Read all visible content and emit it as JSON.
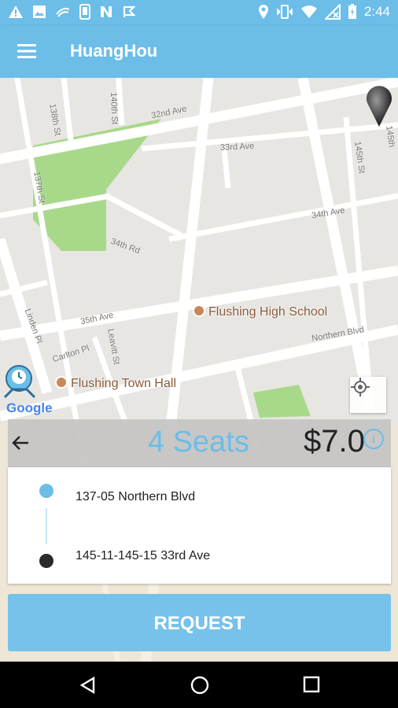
{
  "status_bar": {
    "time": "2:44",
    "left_icons": [
      "warning-icon",
      "image-icon",
      "signal-app-icon",
      "phone-icon",
      "n-icon",
      "flag-icon"
    ],
    "right_icons": [
      "location-icon",
      "vibrate-icon",
      "wifi-icon",
      "no-signal-icon",
      "battery-icon"
    ]
  },
  "app_bar": {
    "title": "HuangHou",
    "menu_icon": "menu-icon"
  },
  "map": {
    "streets": {
      "s138": "138th St",
      "s140": "140th St",
      "ave32": "32nd Ave",
      "ave33": "33rd Ave",
      "s145": "145th St",
      "s145b": "145th",
      "s137": "137th St",
      "rd34": "34th Rd",
      "ave34": "34th Ave",
      "ave35": "35th Ave",
      "linden": "Linden Pl",
      "carlton": "Carlton Pl",
      "leavitt": "Leavitt St",
      "northern": "Northern Blvd"
    },
    "poi_high_school": "Flushing High School",
    "poi_town_hall": "Flushing Town Hall",
    "google": "Google",
    "colors": {
      "park": "#a8d98a",
      "road": "#ffffff",
      "land": "#e8e6e2"
    }
  },
  "booking": {
    "seats": "4 Seats",
    "price": "$7.0",
    "info_icon": "i",
    "pickup": "137-05 Northern Blvd",
    "dropoff": "145-11-145-15 33rd Ave"
  },
  "request_button": "REQUEST",
  "nav_bar": {
    "icons": [
      "back-triangle-icon",
      "home-circle-icon",
      "recents-square-icon"
    ]
  },
  "colors": {
    "accent": "#6cbde8",
    "button": "#77c2ea",
    "seats_bar": "#c4c4c4"
  }
}
